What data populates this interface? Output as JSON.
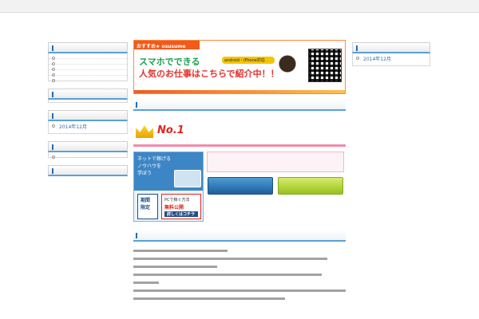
{
  "topbar": {
    "tagline": "",
    "right_link": ""
  },
  "site": {
    "title": ""
  },
  "left_sidebar": {
    "recent": {
      "heading": "",
      "items": [
        "",
        "",
        "",
        "",
        ""
      ]
    },
    "comments": {
      "heading": ""
    },
    "archives": {
      "heading": "",
      "items": [
        "2014年12月"
      ]
    },
    "categories": {
      "heading": "",
      "items": [
        ""
      ]
    },
    "meta": {
      "heading": "",
      "lines": [
        "",
        ""
      ]
    }
  },
  "right_sidebar": {
    "archives": {
      "heading": "",
      "items": [
        "2014年12月"
      ]
    }
  },
  "main": {
    "banner": {
      "tab": "おすすめ★ osusume",
      "line1": "スマホでできる",
      "pill": "android・iPhone対応",
      "line2": "人気のお仕事はこちらで紹介中！！"
    },
    "section1_title": "",
    "no1": {
      "number": "No.1",
      "text": ""
    },
    "ad": {
      "headline": "ネットで稼げる\nノウハウを\n学ぼう",
      "badge": "期間\n限定",
      "free_line1": "PCで稼ぐ方法",
      "free_line2": "無料公開",
      "free_btn": "詳しくはコチラ"
    },
    "pink_text": "",
    "buttons": {
      "blue": "",
      "green": ""
    },
    "section2_title": ""
  }
}
